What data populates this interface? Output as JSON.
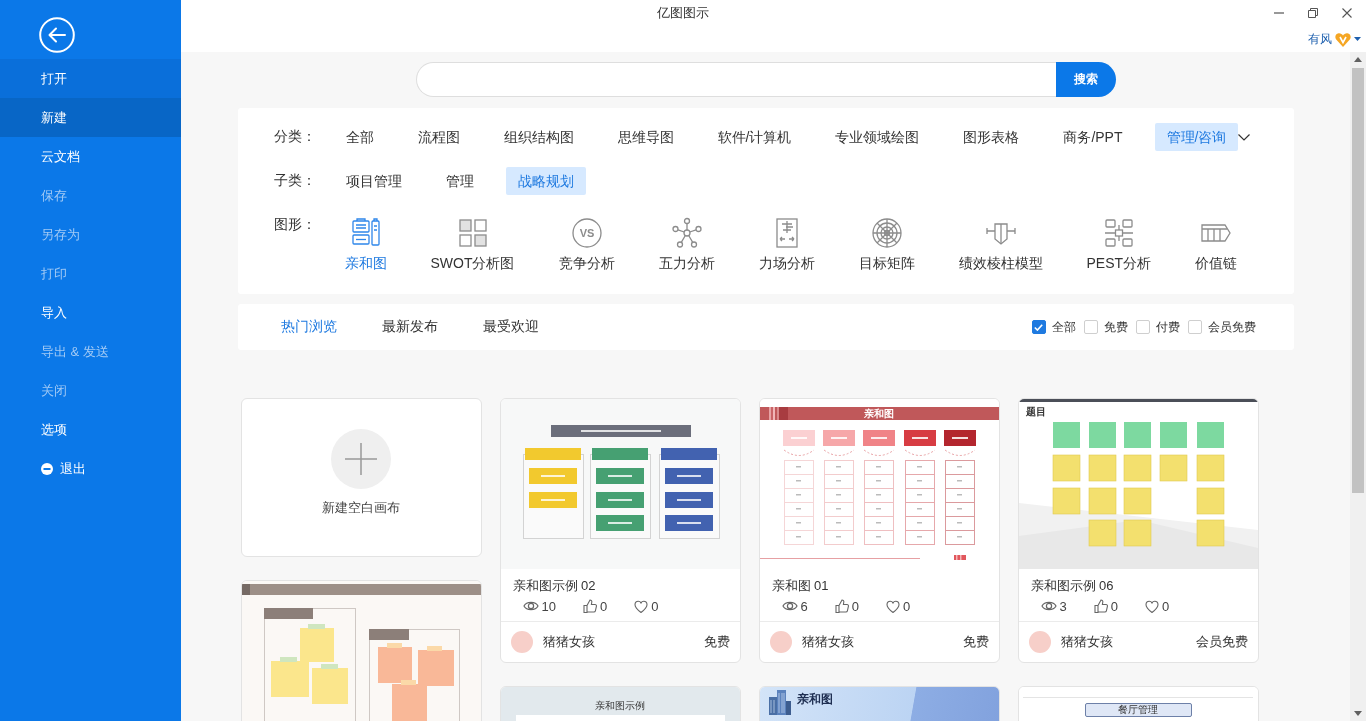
{
  "window": {
    "title": "亿图图示"
  },
  "account": {
    "name": "有风"
  },
  "sidebar": {
    "items": [
      {
        "kind": "item",
        "label": "打开",
        "selected": false,
        "hovered": true,
        "disabled": false
      },
      {
        "kind": "item",
        "label": "新建",
        "selected": true,
        "hovered": false,
        "disabled": false
      },
      {
        "kind": "item",
        "label": "云文档",
        "selected": false,
        "hovered": false,
        "disabled": false
      },
      {
        "kind": "item",
        "label": "保存",
        "selected": false,
        "hovered": false,
        "disabled": true
      },
      {
        "kind": "item",
        "label": "另存为",
        "selected": false,
        "hovered": false,
        "disabled": true
      },
      {
        "kind": "item",
        "label": "打印",
        "selected": false,
        "hovered": false,
        "disabled": true
      },
      {
        "kind": "item",
        "label": "导入",
        "selected": false,
        "hovered": false,
        "disabled": false
      },
      {
        "kind": "item",
        "label": "导出 & 发送",
        "selected": false,
        "hovered": false,
        "disabled": true
      },
      {
        "kind": "item",
        "label": "关闭",
        "selected": false,
        "hovered": false,
        "disabled": true
      },
      {
        "kind": "item",
        "label": "选项",
        "selected": false,
        "hovered": false,
        "disabled": false
      },
      {
        "kind": "exit",
        "label": "退出",
        "selected": false,
        "hovered": false,
        "disabled": false
      }
    ]
  },
  "search": {
    "button": "搜索"
  },
  "filters": {
    "category": {
      "label": "分类：",
      "options": [
        {
          "label": "全部",
          "selected": false
        },
        {
          "label": "流程图",
          "selected": false
        },
        {
          "label": "组织结构图",
          "selected": false
        },
        {
          "label": "思维导图",
          "selected": false
        },
        {
          "label": "软件/计算机",
          "selected": false
        },
        {
          "label": "专业领域绘图",
          "selected": false
        },
        {
          "label": "图形表格",
          "selected": false
        },
        {
          "label": "商务/PPT",
          "selected": false
        },
        {
          "label": "管理/咨询",
          "selected": true
        }
      ]
    },
    "subcategory": {
      "label": "子类：",
      "options": [
        {
          "label": "项目管理",
          "selected": false
        },
        {
          "label": "管理",
          "selected": false
        },
        {
          "label": "战略规划",
          "selected": true
        }
      ]
    },
    "shapes": {
      "label": "图形：",
      "options": [
        {
          "label": "亲和图",
          "selected": true
        },
        {
          "label": "SWOT分析图",
          "selected": false
        },
        {
          "label": "竞争分析",
          "selected": false,
          "icon_text": "VS"
        },
        {
          "label": "五力分析",
          "selected": false
        },
        {
          "label": "力场分析",
          "selected": false
        },
        {
          "label": "目标矩阵",
          "selected": false
        },
        {
          "label": "绩效棱柱模型",
          "selected": false
        },
        {
          "label": "PEST分析",
          "selected": false
        },
        {
          "label": "价值链",
          "selected": false
        }
      ]
    }
  },
  "sort": {
    "tabs": [
      {
        "label": "热门浏览",
        "selected": true
      },
      {
        "label": "最新发布",
        "selected": false
      },
      {
        "label": "最受欢迎",
        "selected": false
      }
    ],
    "price_filters": [
      {
        "label": "全部",
        "checked": true
      },
      {
        "label": "免费",
        "checked": false
      },
      {
        "label": "付费",
        "checked": false
      },
      {
        "label": "会员免费",
        "checked": false
      }
    ]
  },
  "cards": {
    "columns": [
      [
        {
          "kind": "new",
          "label": "新建空白画布"
        },
        {
          "kind": "template",
          "thumbnail": {
            "kind": "note-groups"
          }
        }
      ],
      [
        {
          "kind": "template",
          "thumbnail": {
            "kind": "columns"
          },
          "title": "亲和图示例 02",
          "views": "10",
          "likes": "0",
          "favorites": "0",
          "author": "猪猪女孩",
          "price": "免费"
        },
        {
          "kind": "template",
          "thumbnail": {
            "kind": "banner",
            "title": "亲和图示例"
          }
        }
      ],
      [
        {
          "kind": "template",
          "thumbnail": {
            "kind": "red-table",
            "title": "亲和图"
          },
          "title": "亲和图 01",
          "views": "6",
          "likes": "0",
          "favorites": "0",
          "author": "猪猪女孩",
          "price": "免费"
        },
        {
          "kind": "template",
          "thumbnail": {
            "kind": "blue-banner",
            "title": "亲和图"
          }
        }
      ],
      [
        {
          "kind": "template",
          "thumbnail": {
            "kind": "sticky-notes",
            "title": "题目"
          },
          "title": "亲和图示例 06",
          "views": "3",
          "likes": "0",
          "favorites": "0",
          "author": "猪猪女孩",
          "price": "会员免费"
        },
        {
          "kind": "template",
          "thumbnail": {
            "kind": "boxed",
            "title": "餐厅管理"
          }
        }
      ]
    ]
  }
}
